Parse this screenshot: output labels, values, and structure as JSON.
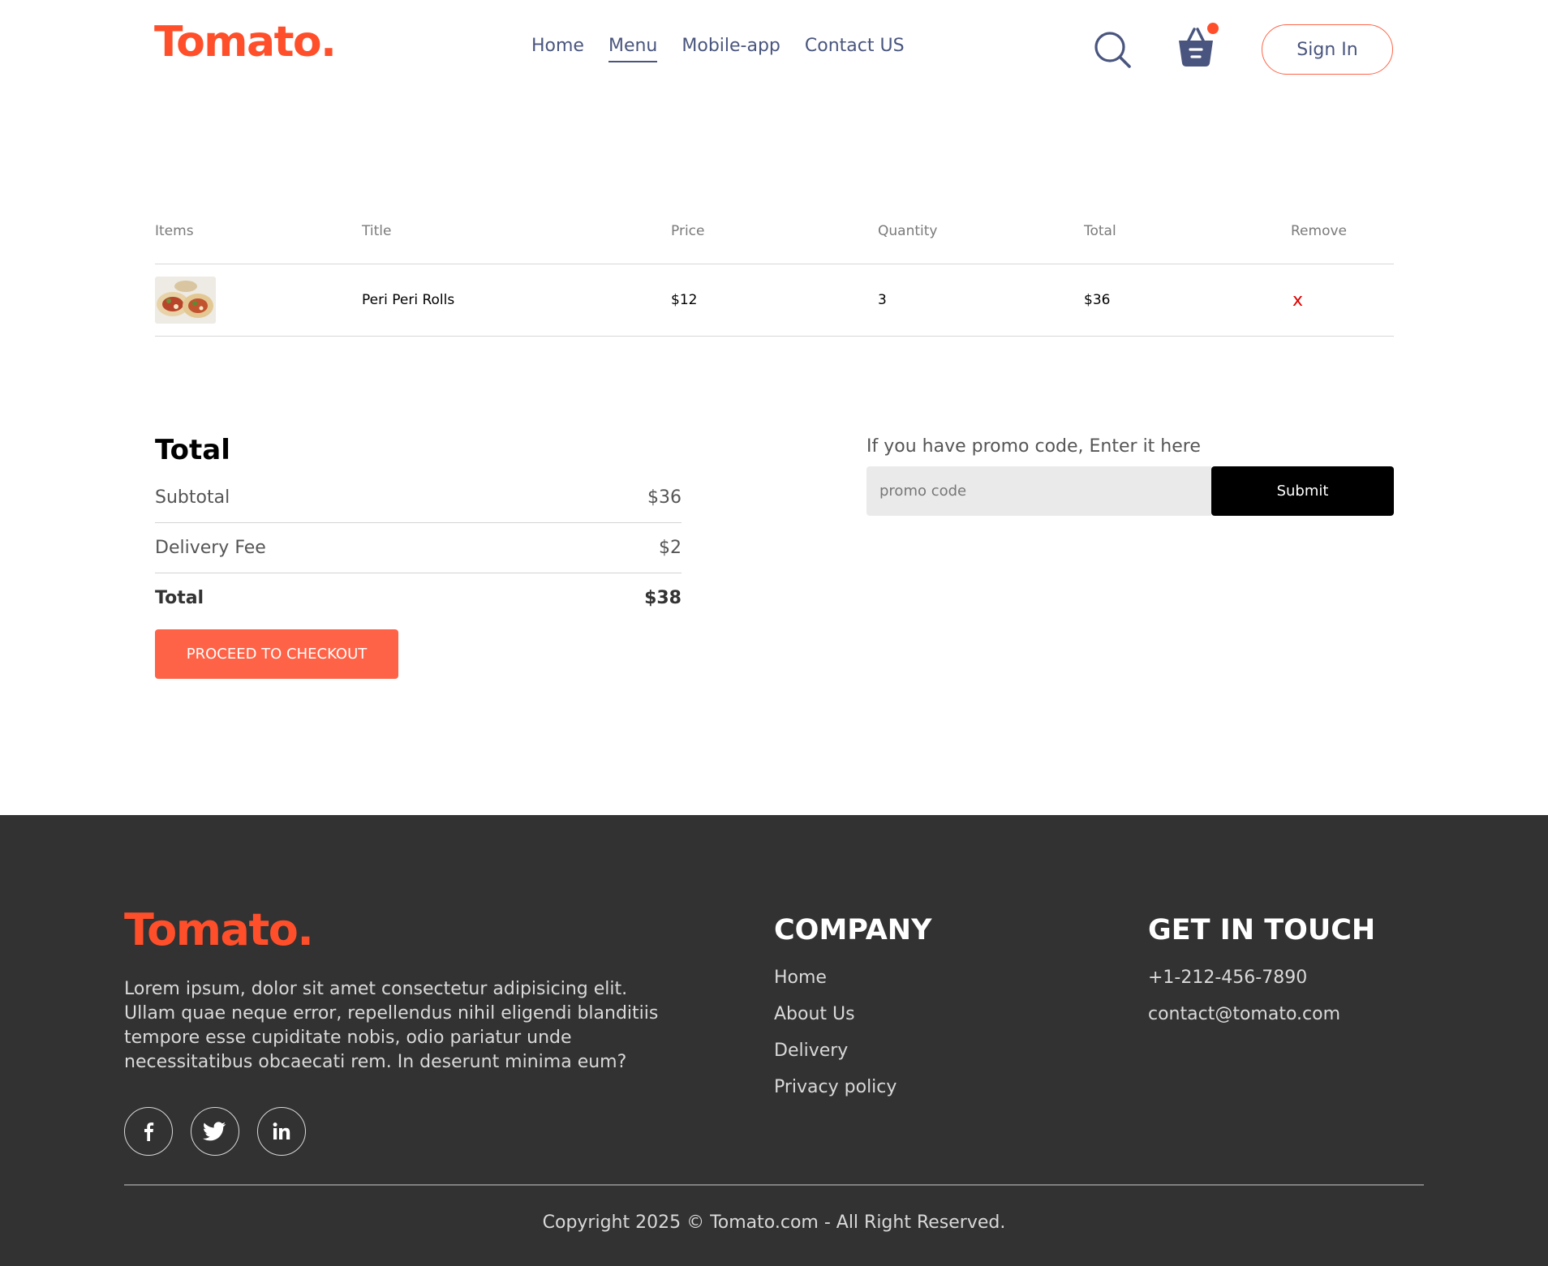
{
  "brand": {
    "logo": "Tomato.",
    "accent_color": "#ff6347",
    "logo_color": "#ff4f2a"
  },
  "nav": {
    "links": [
      "Home",
      "Menu",
      "Mobile-app",
      "Contact US"
    ],
    "active": "Menu",
    "signin_label": "Sign In"
  },
  "icons": {
    "search": "search-icon",
    "basket": "basket-icon",
    "remove": "close-icon"
  },
  "cart": {
    "headers": [
      "Items",
      "Title",
      "Price",
      "Quantity",
      "Total",
      "Remove"
    ],
    "rows": [
      {
        "title": "Peri Peri Rolls",
        "price": "$12",
        "quantity": "3",
        "total": "$36",
        "remove": "x"
      }
    ]
  },
  "totals": {
    "heading": "Total",
    "subtotal_label": "Subtotal",
    "subtotal_value": "$36",
    "delivery_label": "Delivery Fee",
    "delivery_value": "$2",
    "total_label": "Total",
    "total_value": "$38",
    "checkout_label": "PROCEED TO CHECKOUT"
  },
  "promo": {
    "label": "If you have promo code, Enter it here",
    "placeholder": "promo code",
    "submit_label": "Submit"
  },
  "footer": {
    "logo": "Tomato.",
    "description": "Lorem ipsum, dolor sit amet consectetur adipisicing elit. Ullam quae neque error, repellendus nihil eligendi blanditiis tempore esse cupiditate nobis, odio pariatur unde necessitatibus obcaecati rem. In deserunt minima eum?",
    "socials": [
      "facebook-icon",
      "twitter-icon",
      "linkedin-icon"
    ],
    "company_heading": "COMPANY",
    "company_links": [
      "Home",
      "About Us",
      "Delivery",
      "Privacy policy"
    ],
    "contact_heading": "GET IN TOUCH",
    "phone": "+1-212-456-7890",
    "email": "contact@tomato.com",
    "copyright": "Copyright 2025 © Tomato.com - All Right Reserved."
  }
}
